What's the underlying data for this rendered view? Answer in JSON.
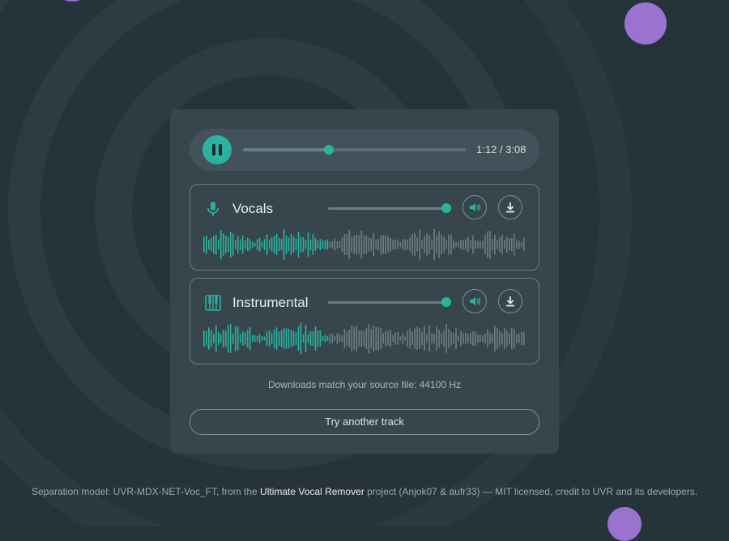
{
  "colors": {
    "accent": "#2bb3a0",
    "inactive_wave": "#6f7c81",
    "blob": "#9a72d0"
  },
  "player": {
    "state": "playing",
    "progress": 0.385,
    "time": "1:12 / 3:08"
  },
  "stems": [
    {
      "name": "Vocals",
      "icon": "microphone-icon",
      "volume": 1.0
    },
    {
      "name": "Instrumental",
      "icon": "piano-icon",
      "volume": 1.0
    }
  ],
  "note": "Downloads match your source file: 44100 Hz",
  "try_button": "Try another track",
  "footer": {
    "prefix": "Separation model: UVR-MDX-NET-Voc_FT, from the ",
    "link": "Ultimate Vocal Remover",
    "suffix": " project (Anjok07 & aufr33) — MIT licensed, credit to UVR and its developers."
  }
}
